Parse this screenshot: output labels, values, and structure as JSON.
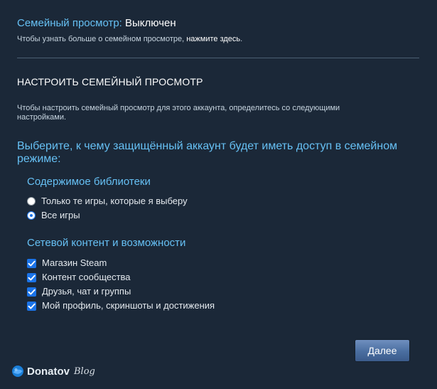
{
  "status": {
    "label": "Семейный просмотр:",
    "value": "Выключен"
  },
  "learn_more": {
    "text": "Чтобы узнать больше о семейном просмотре,",
    "link": "нажмите здесь",
    "suffix": "."
  },
  "setup": {
    "title": "НАСТРОИТЬ СЕМЕЙНЫЙ ПРОСМОТР",
    "description": "Чтобы настроить семейный просмотр для этого аккаунта, определитесь со следующими настройками."
  },
  "access": {
    "question": "Выберите, к чему защищённый аккаунт будет иметь доступ в семейном режиме:"
  },
  "library": {
    "title": "Содержимое библиотеки",
    "options": [
      {
        "label": "Только те игры, которые я выберу",
        "selected": false
      },
      {
        "label": "Все игры",
        "selected": true
      }
    ]
  },
  "online": {
    "title": "Сетевой контент и возможности",
    "items": [
      {
        "label": "Магазин Steam",
        "checked": true
      },
      {
        "label": "Контент сообщества",
        "checked": true
      },
      {
        "label": "Друзья, чат и группы",
        "checked": true
      },
      {
        "label": "Мой профиль, скриншоты и достижения",
        "checked": true
      }
    ]
  },
  "actions": {
    "next_label": "Далее"
  },
  "watermark": {
    "brand": "Donatov",
    "blog": "Blog",
    "icon": "donatov-logo-icon"
  },
  "colors": {
    "background": "#1b2838",
    "accent": "#66c0f4",
    "control": "#1a73e8",
    "text": "#c7d5e0",
    "button": "#4a6ea0"
  }
}
